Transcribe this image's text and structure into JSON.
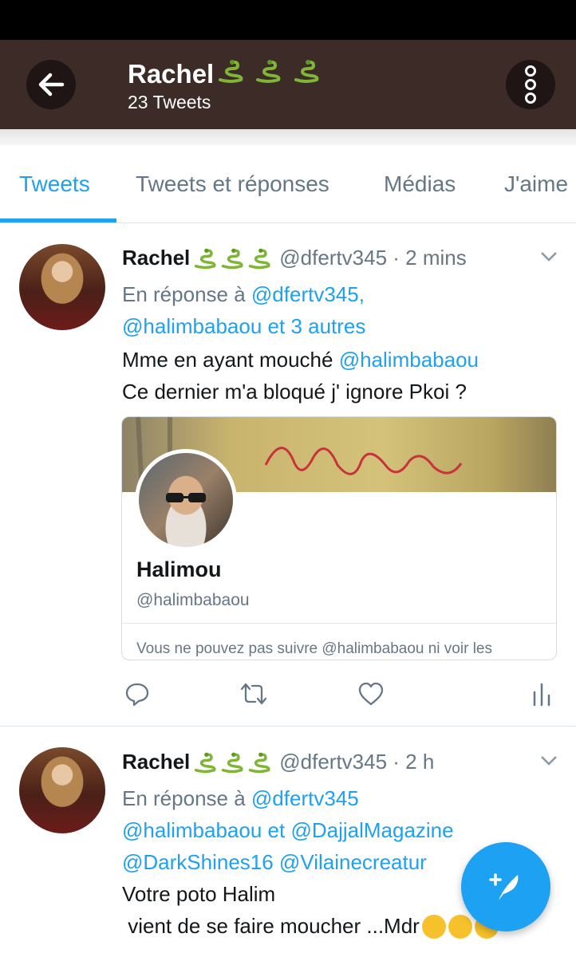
{
  "header": {
    "name": "Rachel",
    "tweet_count": "23 Tweets"
  },
  "tabs": [
    {
      "label": "Tweets",
      "active": true
    },
    {
      "label": "Tweets et réponses",
      "active": false
    },
    {
      "label": "Médias",
      "active": false
    },
    {
      "label": "J'aime",
      "active": false
    }
  ],
  "tweets": [
    {
      "name": "Rachel",
      "handle": "@dfertv345 · 2 mins",
      "reply_prefix": "En réponse à",
      "reply_line1_mentions": "@dfertv345,",
      "reply_line2_mention": "@halimbabaou",
      "reply_line2_rest": "et 3 autres",
      "text_line1_prefix": "Mme en ayant mouché",
      "text_line1_mention": "@halimbabaou",
      "text_line2": "Ce dernier m'a bloqué j' ignore Pkoi ?",
      "card": {
        "name": "Halimou",
        "handle": "@halimbabaou",
        "note": "Vous ne pouvez pas suivre @halimbabaou ni voir les"
      }
    },
    {
      "name": "Rachel",
      "handle": "@dfertv345 · 2 h",
      "reply_prefix": "En réponse à",
      "reply_line1_mentions": "@dfertv345",
      "reply_line2_mention1": "@halimbabaou",
      "reply_line2_joiner": "et",
      "reply_line2_mention2": "@DajjalMagazine",
      "reply_line3": "@DarkShines16 @Vilainecreatur",
      "text_line1": "Votre poto Halim",
      "text_line2": " vient de se faire moucher ...Mdr"
    }
  ],
  "colors": {
    "header_bg": "#3d2b28",
    "accent": "#1da1f2",
    "secondary_text": "#657786"
  },
  "icons": [
    "back-arrow-icon",
    "more-vert-icon",
    "snake-emoji-icon",
    "chevron-down-icon",
    "reply-icon",
    "retweet-icon",
    "like-icon",
    "analytics-icon",
    "compose-icon",
    "grin-emoji-icon"
  ]
}
